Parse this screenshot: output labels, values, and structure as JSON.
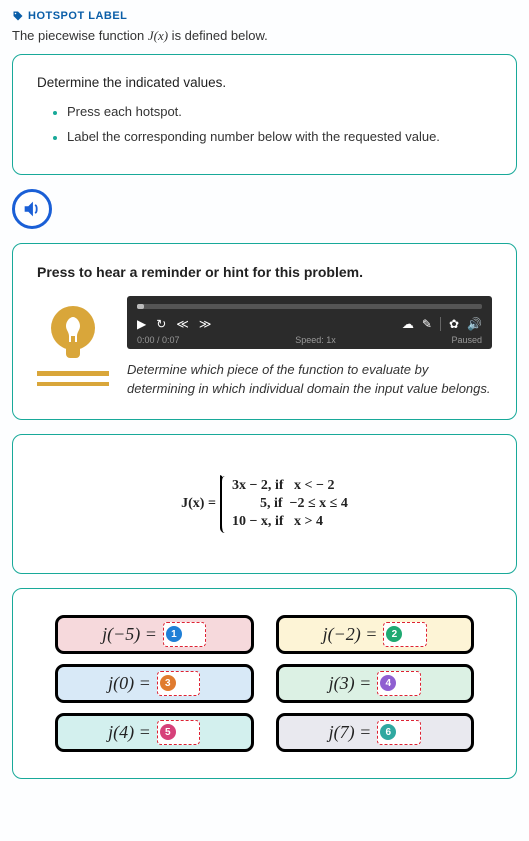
{
  "header": {
    "label": "HOTSPOT LABEL"
  },
  "intro": {
    "prefix": "The piecewise function ",
    "fn": "J(x)",
    "suffix": " is defined below."
  },
  "instructions": {
    "title": "Determine the indicated values.",
    "items": [
      "Press each hotspot.",
      "Label the corresponding number below with the requested value."
    ]
  },
  "hint": {
    "title": "Press to hear a reminder or hint for this problem.",
    "player": {
      "time": "0:00 / 0:07",
      "speed": "Speed: 1x",
      "status": "Paused"
    },
    "text": "Determine which piece of the function to evaluate by determining in which individual domain the input value belongs."
  },
  "piecewise": {
    "lhs": "J(x) =",
    "row1_expr": "3x − 2,",
    "row1_cond": "if   x < − 2",
    "row2_expr": "5,",
    "row2_cond": "if  −2 ≤ x ≤ 4",
    "row3_expr": "10 − x,",
    "row3_cond": "if   x > 4"
  },
  "answers": [
    {
      "label": "j(−5) =",
      "badge": "1"
    },
    {
      "label": "j(−2) =",
      "badge": "2"
    },
    {
      "label": "j(0) =",
      "badge": "3"
    },
    {
      "label": "j(3) =",
      "badge": "4"
    },
    {
      "label": "j(4) =",
      "badge": "5"
    },
    {
      "label": "j(7) =",
      "badge": "6"
    }
  ]
}
